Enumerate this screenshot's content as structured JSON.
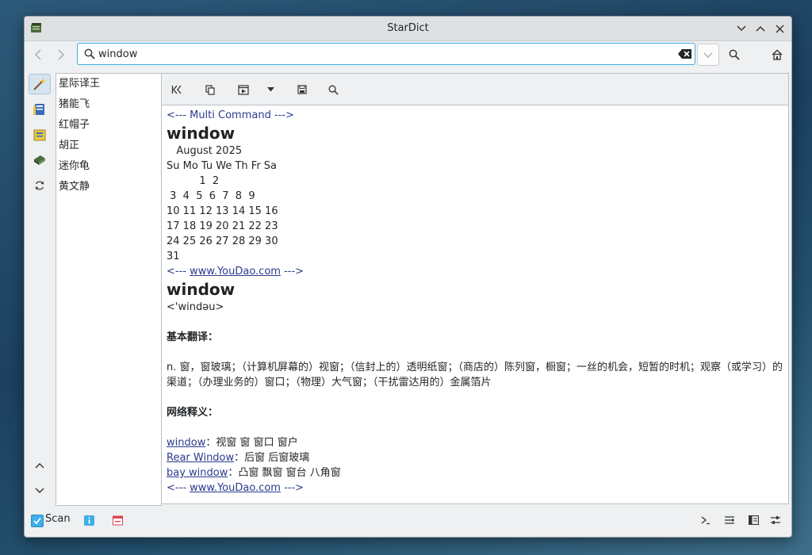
{
  "window": {
    "title": "StarDict"
  },
  "search": {
    "query": "window"
  },
  "sidebar": {
    "words": [
      "星际译王",
      "猪能飞",
      "红帽子",
      "胡正",
      "迷你龟",
      "黄文静"
    ]
  },
  "article": {
    "multi_marker": "<--- Multi Command --->",
    "headword1": "window",
    "cal_month": "August 2025",
    "cal_header": "Su Mo Tu We Th Fr Sa",
    "cal_rows": [
      "          1  2",
      " 3  4  5  6  7  8  9",
      "10 11 12 13 14 15 16",
      "17 18 19 20 21 22 23",
      "24 25 26 27 28 29 30",
      "31"
    ],
    "youdao_prefix": "<--- ",
    "youdao_link": "www.YouDao.com",
    "youdao_suffix": " --->",
    "headword2": "window",
    "phonetic": "<'windəu>",
    "basic_title": "基本翻译：",
    "basic_text": "n. 窗，窗玻璃；（计算机屏幕的）视窗；（信封上的）透明纸窗；（商店的）陈列窗，橱窗；一丝的机会，短暂的时机；观察（或学习）的渠道；（办理业务的）窗口；（物理）大气窗；（干扰雷达用的）金属箔片",
    "net_title": "网络释义：",
    "net_items": [
      {
        "term": "window",
        "sep": "：",
        "meaning": "视窗 窗 窗口 窗户"
      },
      {
        "term": "Rear Window",
        "sep": "：",
        "meaning": "后窗 后窗玻璃"
      },
      {
        "term": "bay window",
        "sep": "：",
        "meaning": "凸窗 飘窗 窗台 八角窗"
      }
    ]
  },
  "status": {
    "scan_label": "Scan",
    "scan_checked": true
  },
  "colors": {
    "accent": "#3daee9",
    "link": "#2b3a8c"
  }
}
